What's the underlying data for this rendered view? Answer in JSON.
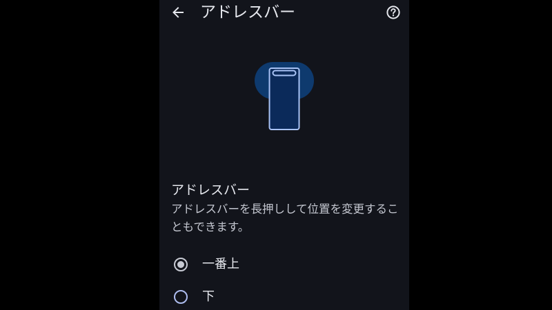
{
  "header": {
    "title": "アドレスバー",
    "back_icon": "arrow-left-icon",
    "help_icon": "help-circle-icon"
  },
  "illustration": {
    "icon": "phone-address-bar-top-icon",
    "colors": {
      "halo": "#0e3a6e",
      "screen": "#0b2a5a",
      "outline": "#a9c3f5"
    }
  },
  "section": {
    "title": "アドレスバー",
    "description": "アドレスバーを長押しして位置を変更することもできます。"
  },
  "options": {
    "top": {
      "label": "一番上",
      "selected": true
    },
    "bottom": {
      "label": "下",
      "selected": false
    }
  },
  "colors": {
    "background": "#12141b",
    "text_primary": "#e6e8ee",
    "text_secondary": "#c4c7d0",
    "radio_selected": "#c7cad3",
    "radio_unselected": "#aebdf0"
  }
}
